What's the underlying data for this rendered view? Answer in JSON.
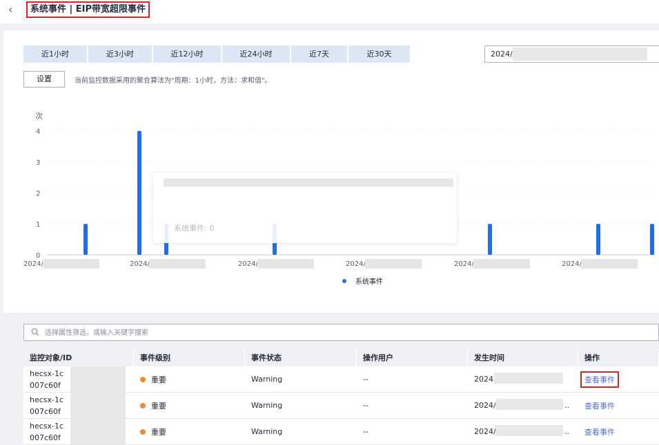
{
  "header": {
    "back_icon": "chevron-left-icon",
    "title": "系统事件 | EIP带宽超限事件"
  },
  "tabs": [
    "近1小时",
    "近3小时",
    "近12小时",
    "近24小时",
    "近7天",
    "近30天"
  ],
  "date_range": {
    "value": "2024/"
  },
  "settings": {
    "button_label": "设置",
    "note": "当前监控数据采用的聚合算法为\"周期：1小时，方法：求和值\"。"
  },
  "chart_data": {
    "type": "bar",
    "ylabel": "次",
    "yticks": [
      "0",
      "1",
      "2",
      "3",
      "4"
    ],
    "ylim": [
      0,
      4
    ],
    "xticks": [
      "2024/",
      "2024/",
      "2024/",
      "2024/",
      "2024/",
      "2024/"
    ],
    "series": [
      {
        "name": "系统事件",
        "color": "#1f6feb",
        "values": [
          1,
          4,
          1,
          1,
          1,
          1,
          1
        ]
      }
    ],
    "legend": "bottom",
    "grid": true
  },
  "tooltip": {
    "text": "系统事件: 0"
  },
  "search": {
    "placeholder": "选择属性筛选，或输入关键字搜索"
  },
  "table": {
    "columns": [
      "监控对象/ID",
      "事件级别",
      "事件状态",
      "操作用户",
      "发生时间",
      "操作"
    ],
    "rows": [
      {
        "name": "hecsx-1c",
        "id": "007c60f",
        "level": "重要",
        "status": "Warning",
        "user": "--",
        "time": "2024",
        "action": "查看事件"
      },
      {
        "name": "hecsx-1c",
        "id": "007c60f",
        "level": "重要",
        "status": "Warning",
        "user": "--",
        "time": "2024/",
        "time_suffix": "..",
        "action": "查看事件"
      },
      {
        "name": "hecsx-1c",
        "id": "007c60f",
        "level": "重要",
        "status": "Warning",
        "user": "--",
        "time": "2024/",
        "time_suffix": "..",
        "action": "查看事件"
      }
    ]
  }
}
